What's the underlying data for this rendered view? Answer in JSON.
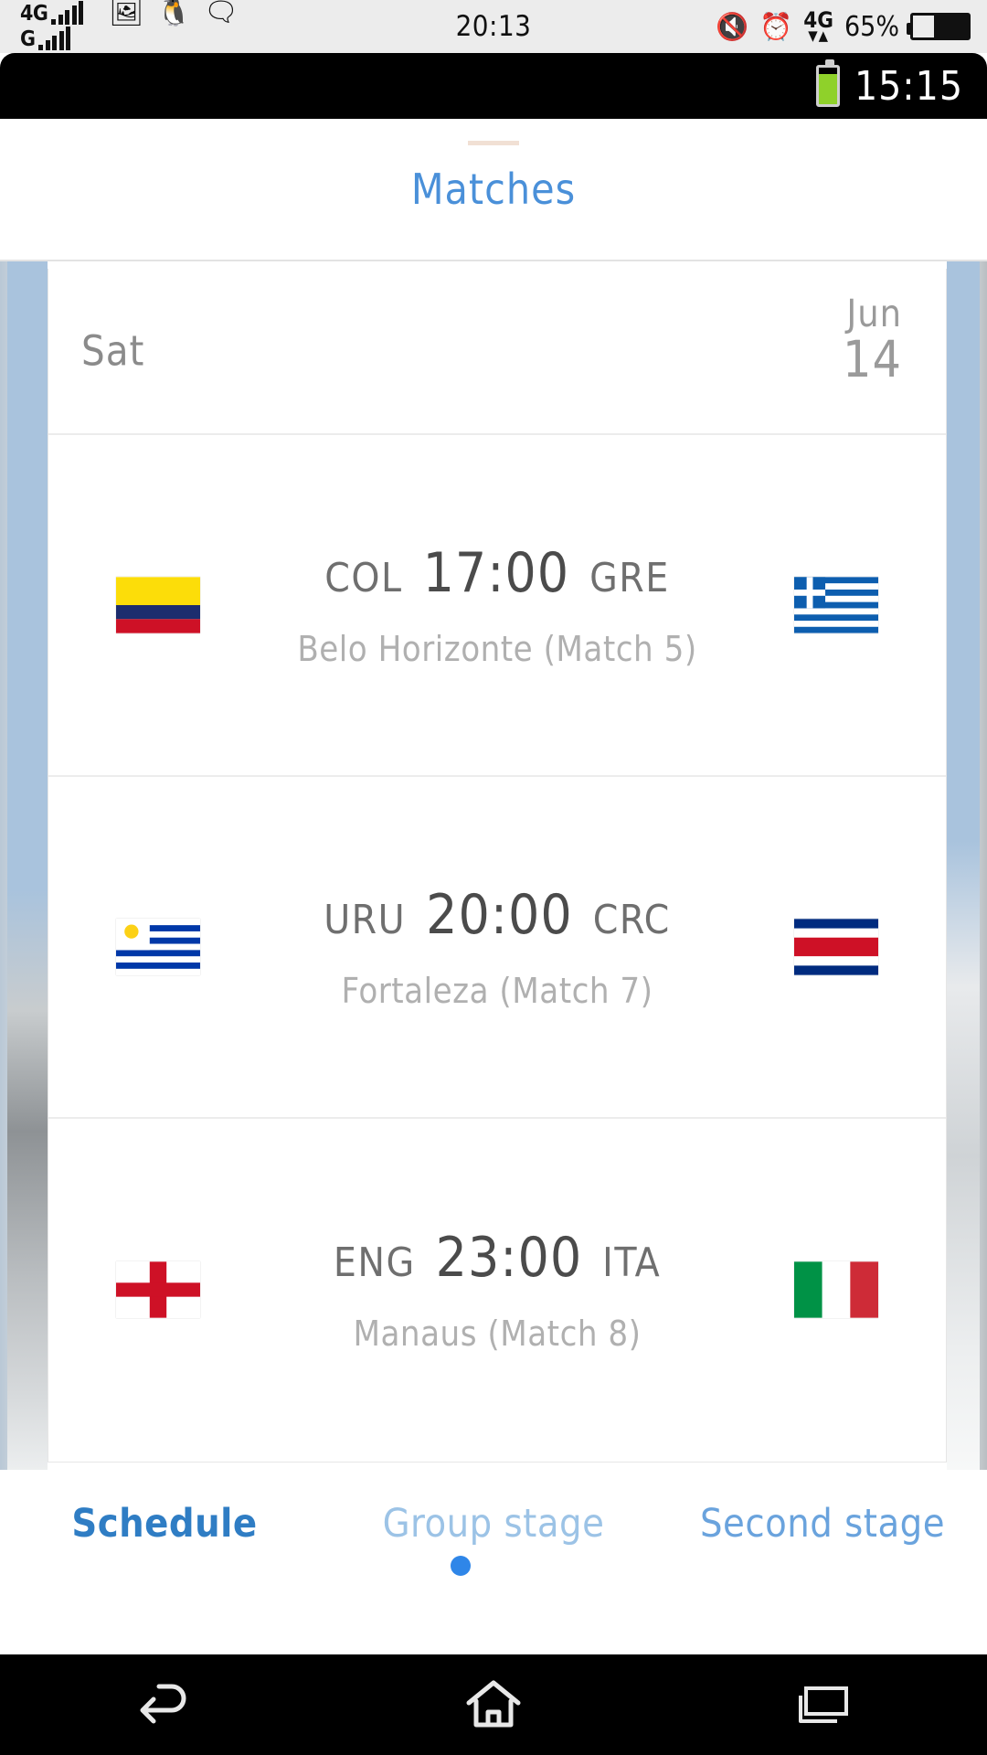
{
  "host_status_bar": {
    "network_primary": "4G",
    "network_secondary": "G",
    "time": "20:13",
    "battery_percent": "65%",
    "data_indicator": "4G",
    "icons": [
      "photo-icon",
      "qq-penguin-icon",
      "wechat-icon",
      "mute-icon",
      "alarm-icon",
      "data-transfer-icon",
      "battery-icon"
    ]
  },
  "device_status_bar": {
    "time": "15:15",
    "battery": "battery-icon"
  },
  "app": {
    "title": "Matches"
  },
  "schedule": {
    "date_header": {
      "day_of_week": "Sat",
      "month": "Jun",
      "day": "14"
    },
    "matches": [
      {
        "home_code": "COL",
        "away_code": "GRE",
        "time": "17:00",
        "venue": "Belo Horizonte (Match  5)",
        "home_flag": "colombia-flag",
        "away_flag": "greece-flag"
      },
      {
        "home_code": "URU",
        "away_code": "CRC",
        "time": "20:00",
        "venue": "Fortaleza (Match  7)",
        "home_flag": "uruguay-flag",
        "away_flag": "costa-rica-flag"
      },
      {
        "home_code": "ENG",
        "away_code": "ITA",
        "time": "23:00",
        "venue": "Manaus (Match  8)",
        "home_flag": "england-flag",
        "away_flag": "italy-flag"
      }
    ]
  },
  "tabs": [
    {
      "label": "Schedule",
      "active": true
    },
    {
      "label": "Group stage",
      "active": false
    },
    {
      "label": "Second stage",
      "active": false
    }
  ],
  "nav_bar": {
    "back": "back-icon",
    "home": "home-icon",
    "recents": "recents-icon"
  },
  "colors": {
    "accent_blue": "#4a90d9",
    "tab_active": "#2f7dc4",
    "tab_inactive": "#9cc3e6",
    "card_border": "#a9c3dd",
    "dot": "#2f86e8"
  }
}
